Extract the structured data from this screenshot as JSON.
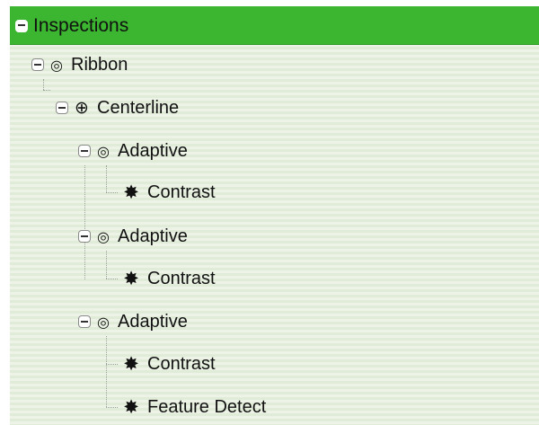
{
  "tree": {
    "root": {
      "label": "Inspections",
      "expanded": true,
      "icon": "collapse-toggle"
    },
    "nodes": [
      {
        "label": "Ribbon",
        "icon": "target-icon",
        "level": 1,
        "expanded": true
      },
      {
        "label": "Centerline",
        "icon": "crosshair-icon",
        "level": 2,
        "expanded": true
      },
      {
        "label": "Adaptive",
        "icon": "target-icon",
        "level": 3,
        "expanded": true
      },
      {
        "label": "Contrast",
        "icon": "star-icon",
        "level": 4
      },
      {
        "label": "Adaptive",
        "icon": "target-icon",
        "level": 3,
        "expanded": true
      },
      {
        "label": "Contrast",
        "icon": "star-icon",
        "level": 4
      },
      {
        "label": "Adaptive",
        "icon": "target-icon",
        "level": 3,
        "expanded": true
      },
      {
        "label": "Contrast",
        "icon": "star-icon",
        "level": 4
      },
      {
        "label": "Feature Detect",
        "icon": "star-icon",
        "level": 4
      }
    ],
    "colors": {
      "header_bg": "#3cb530",
      "panel_bg": "#e6efdf",
      "text": "#111111"
    }
  }
}
